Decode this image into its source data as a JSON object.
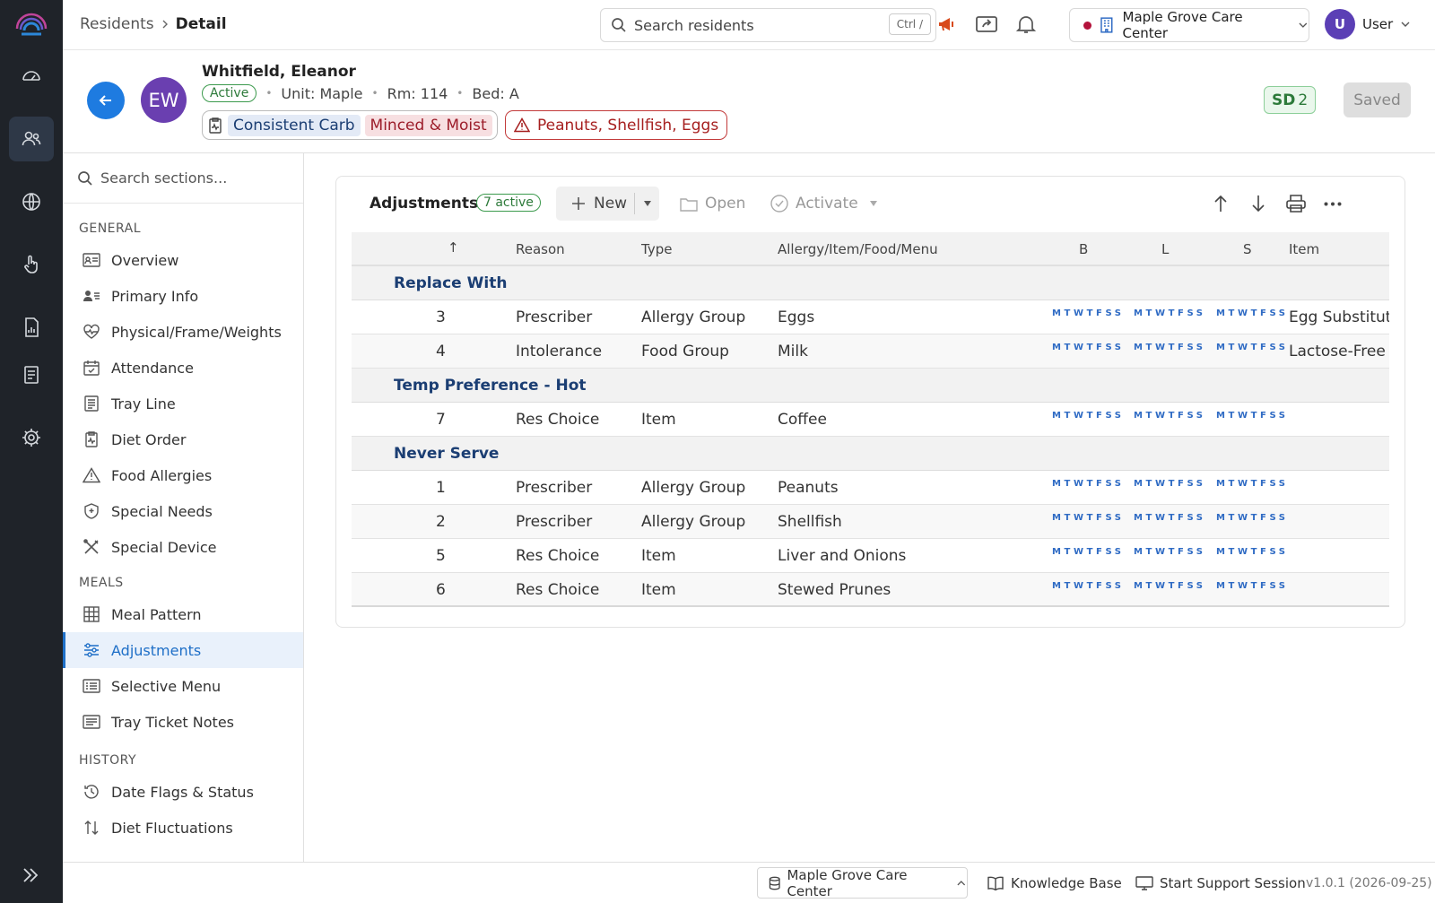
{
  "breadcrumb": {
    "parent": "Residents",
    "current": "Detail"
  },
  "search": {
    "placeholder": "Search residents",
    "shortcut": "Ctrl /"
  },
  "facility": {
    "name": "Maple Grove Care Center"
  },
  "user": {
    "initial": "U",
    "name": "User"
  },
  "resident": {
    "initials": "EW",
    "name": "Whitfield, Eleanor",
    "status": "Active",
    "unit": "Unit: Maple",
    "room": "Rm: 114",
    "bed": "Bed: A",
    "diet_1": "Consistent Carb",
    "diet_2": "Minced & Moist",
    "allergies": "Peanuts, Shellfish, Eggs",
    "sd_label": "SD",
    "sd_count": "2",
    "saved_label": "Saved"
  },
  "nav": {
    "search_placeholder": "Search sections...",
    "general_heading": "GENERAL",
    "meals_heading": "MEALS",
    "history_heading": "HISTORY",
    "items": [
      {
        "label": "Overview",
        "icon": "id-card-icon"
      },
      {
        "label": "Primary Info",
        "icon": "person-lines-icon"
      },
      {
        "label": "Physical/Frame/Weights",
        "icon": "heart-pulse-icon"
      },
      {
        "label": "Attendance",
        "icon": "calendar-check-icon"
      },
      {
        "label": "Tray Line",
        "icon": "receipt-icon"
      },
      {
        "label": "Diet Order",
        "icon": "clipboard-pulse-icon"
      },
      {
        "label": "Food Allergies",
        "icon": "warning-icon"
      },
      {
        "label": "Special Needs",
        "icon": "shield-icon"
      },
      {
        "label": "Special Device",
        "icon": "tools-icon"
      },
      {
        "label": "Meal Pattern",
        "icon": "grid-icon"
      },
      {
        "label": "Adjustments",
        "icon": "sliders-icon"
      },
      {
        "label": "Selective Menu",
        "icon": "list-card-icon"
      },
      {
        "label": "Tray Ticket Notes",
        "icon": "notes-icon"
      },
      {
        "label": "Date Flags & Status",
        "icon": "clock-icon"
      },
      {
        "label": "Diet Fluctuations",
        "icon": "arrows-updown-icon"
      }
    ]
  },
  "adjustments": {
    "title": "Adjustments",
    "active_badge": "7 active",
    "toolbar": {
      "new": "New",
      "open": "Open",
      "activate": "Activate"
    },
    "columns": {
      "sort": "↑",
      "reason": "Reason",
      "type": "Type",
      "target": "Allergy/Item/Food/Menu",
      "b": "B",
      "l": "L",
      "s": "S",
      "item": "Item"
    },
    "days": "MTWTFSS",
    "groups": [
      {
        "label": "Replace With"
      },
      {
        "label": "Temp Preference - Hot"
      },
      {
        "label": "Never Serve"
      }
    ],
    "rows": [
      {
        "num": "3",
        "reason": "Prescriber",
        "type": "Allergy Group",
        "target": "Eggs",
        "item": "Egg Substitute"
      },
      {
        "num": "4",
        "reason": "Intolerance",
        "type": "Food Group",
        "target": "Milk",
        "item": "Lactose-Free"
      },
      {
        "num": "7",
        "reason": "Res Choice",
        "type": "Item",
        "target": "Coffee",
        "item": ""
      },
      {
        "num": "1",
        "reason": "Prescriber",
        "type": "Allergy Group",
        "target": "Peanuts",
        "item": ""
      },
      {
        "num": "2",
        "reason": "Prescriber",
        "type": "Allergy Group",
        "target": "Shellfish",
        "item": ""
      },
      {
        "num": "5",
        "reason": "Res Choice",
        "type": "Item",
        "target": "Liver and Onions",
        "item": ""
      },
      {
        "num": "6",
        "reason": "Res Choice",
        "type": "Item",
        "target": "Stewed Prunes",
        "item": ""
      }
    ]
  },
  "footer": {
    "facility": "Maple Grove Care Center",
    "knowledge_base": "Knowledge Base",
    "support": "Start Support Session",
    "version": "v1.0.1 (2026-09-25)"
  },
  "colors": {
    "accent": "#1e7be0",
    "rail": "#1f2329",
    "alert": "#a61f1f",
    "success": "#2d7a3a"
  }
}
